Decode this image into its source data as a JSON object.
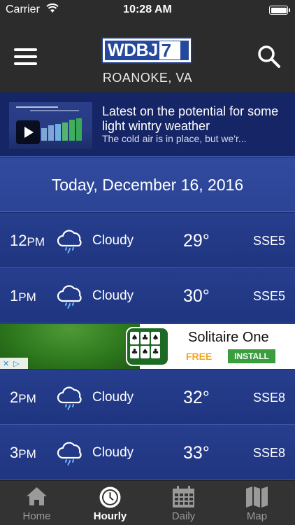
{
  "status_bar": {
    "carrier": "Carrier",
    "time": "10:28 AM"
  },
  "header": {
    "logo_text": "WDBJ",
    "logo_number": "7",
    "location": "ROANOKE, VA",
    "menu_icon": "hamburger-icon",
    "search_icon": "search-icon"
  },
  "news": {
    "headline": "Latest on the potential for some light wintry weather",
    "summary": "The cold air is in place, but we'r..."
  },
  "date_header": "Today, December 16, 2016",
  "hourly": [
    {
      "hour": "12",
      "ampm": "PM",
      "condition": "Cloudy",
      "temp": "29°",
      "wind": "SSE5",
      "icon": "cloudy-rain-icon"
    },
    {
      "hour": "1",
      "ampm": "PM",
      "condition": "Cloudy",
      "temp": "30°",
      "wind": "SSE5",
      "icon": "cloudy-rain-icon"
    },
    {
      "hour": "2",
      "ampm": "PM",
      "condition": "Cloudy",
      "temp": "32°",
      "wind": "SSE8",
      "icon": "cloudy-rain-icon"
    },
    {
      "hour": "3",
      "ampm": "PM",
      "condition": "Cloudy",
      "temp": "33°",
      "wind": "SSE8",
      "icon": "cloudy-rain-icon"
    }
  ],
  "ad": {
    "title": "Solitaire One",
    "price": "FREE",
    "cta": "INSTALL"
  },
  "tabs": [
    {
      "label": "Home",
      "icon": "home-icon",
      "active": false
    },
    {
      "label": "Hourly",
      "icon": "clock-icon",
      "active": true
    },
    {
      "label": "Daily",
      "icon": "calendar-icon",
      "active": false
    },
    {
      "label": "Map",
      "icon": "map-icon",
      "active": false
    }
  ],
  "colors": {
    "header_bg": "#2c2c2c",
    "row_bg": "#273e8e",
    "tabbar_bg": "#333333",
    "install_green": "#3a9e3e",
    "free_orange": "#f2a51a"
  }
}
